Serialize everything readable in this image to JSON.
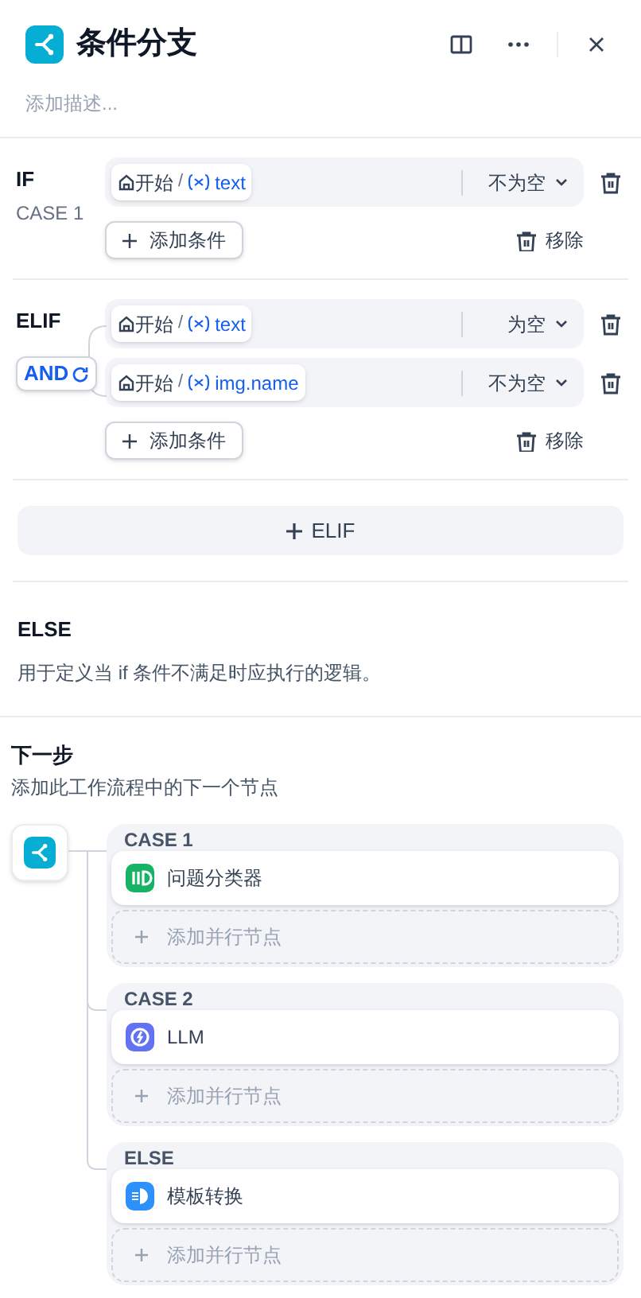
{
  "header": {
    "title": "条件分支",
    "description_placeholder": "添加描述..."
  },
  "cases": [
    {
      "label": "IF",
      "sublabel": "CASE 1",
      "conditions": [
        {
          "node": "开始",
          "separator": "/",
          "variable": "text",
          "operator": "不为空"
        }
      ],
      "add_condition": "添加条件",
      "remove": "移除"
    },
    {
      "label": "ELIF",
      "logical_operator": "AND",
      "conditions": [
        {
          "node": "开始",
          "separator": "/",
          "variable": "text",
          "operator": "为空"
        },
        {
          "node": "开始",
          "separator": "/",
          "variable": "img.name",
          "operator": "不为空"
        }
      ],
      "add_condition": "添加条件",
      "remove": "移除"
    }
  ],
  "elif_button": "ELIF",
  "else": {
    "title": "ELSE",
    "description": "用于定义当 if 条件不满足时应执行的逻辑。"
  },
  "next_step": {
    "title": "下一步",
    "description": "添加此工作流程中的下一个节点",
    "branches": [
      {
        "label": "CASE 1",
        "node": {
          "name": "问题分类器",
          "kind": "classifier",
          "color": "#16b364"
        },
        "add_parallel": "添加并行节点"
      },
      {
        "label": "CASE 2",
        "node": {
          "name": "LLM",
          "kind": "llm",
          "color": "#6172f3"
        },
        "add_parallel": "添加并行节点"
      },
      {
        "label": "ELSE",
        "node": {
          "name": "模板转换",
          "kind": "template",
          "color": "#2e90fa"
        },
        "add_parallel": "添加并行节点"
      }
    ]
  }
}
